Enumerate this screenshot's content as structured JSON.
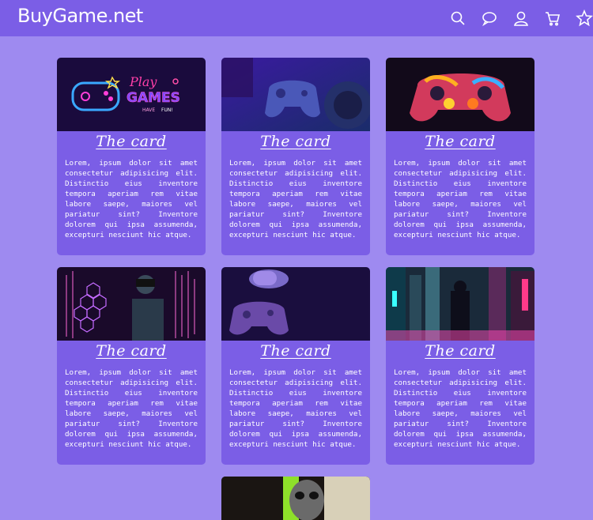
{
  "header": {
    "logo": "BuyGame.net",
    "icons": [
      "search-icon",
      "chat-icon",
      "user-icon",
      "cart-icon",
      "star-icon"
    ]
  },
  "cards": [
    {
      "title": "The card",
      "text": "Lorem, ipsum dolor sit amet consectetur adipisicing elit. Distinctio eius inventore tempora aperiam rem vitae labore saepe, maiores vel pariatur sint? Inventore dolorem qui ipsa assumenda, excepturi nesciunt hic atque.",
      "image": "neon-play-games-sign"
    },
    {
      "title": "The card",
      "text": "Lorem, ipsum dolor sit amet consectetur adipisicing elit. Distinctio eius inventore tempora aperiam rem vitae labore saepe, maiores vel pariatur sint? Inventore dolorem qui ipsa assumenda, excepturi nesciunt hic atque.",
      "image": "gamepad-on-desk"
    },
    {
      "title": "The card",
      "text": "Lorem, ipsum dolor sit amet consectetur adipisicing elit. Distinctio eius inventore tempora aperiam rem vitae labore saepe, maiores vel pariatur sint? Inventore dolorem qui ipsa assumenda, excepturi nesciunt hic atque.",
      "image": "colorful-gamepad"
    },
    {
      "title": "The card",
      "text": "Lorem, ipsum dolor sit amet consectetur adipisicing elit. Distinctio eius inventore tempora aperiam rem vitae labore saepe, maiores vel pariatur sint? Inventore dolorem qui ipsa assumenda, excepturi nesciunt hic atque.",
      "image": "vr-man-hexagons"
    },
    {
      "title": "The card",
      "text": "Lorem, ipsum dolor sit amet consectetur adipisicing elit. Distinctio eius inventore tempora aperiam rem vitae labore saepe, maiores vel pariatur sint? Inventore dolorem qui ipsa assumenda, excepturi nesciunt hic atque.",
      "image": "controller-headphones"
    },
    {
      "title": "The card",
      "text": "Lorem, ipsum dolor sit amet consectetur adipisicing elit. Distinctio eius inventore tempora aperiam rem vitae labore saepe, maiores vel pariatur sint? Inventore dolorem qui ipsa assumenda, excepturi nesciunt hic atque.",
      "image": "cyberpunk-city"
    }
  ],
  "colors": {
    "page_bg": "#9e8af0",
    "header_bg": "#7b5ee6",
    "card_bg": "#7b5ee6"
  }
}
